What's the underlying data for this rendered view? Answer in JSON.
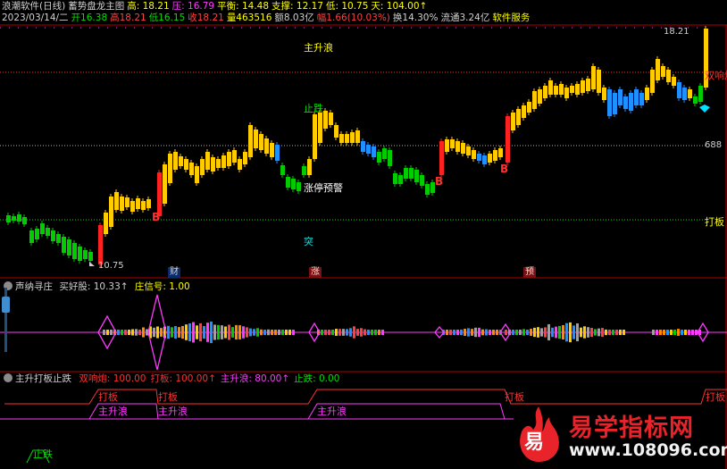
{
  "header": {
    "row1": [
      {
        "text": "浪潮软件(日线)",
        "color": "#d0d0d0"
      },
      {
        "text": "蓄势盘龙主图",
        "color": "#d0d0d0"
      },
      {
        "text": "高: 18.21",
        "color": "#ffff00"
      },
      {
        "text": "压: 16.79",
        "color": "#ff3bff"
      },
      {
        "text": "平衡: 14.48",
        "color": "#ffff00"
      },
      {
        "text": "支撑: 12.17",
        "color": "#ffff00"
      },
      {
        "text": "低: 10.75",
        "color": "#ffff00"
      },
      {
        "text": "天: 104.00↑",
        "color": "#ffff00"
      }
    ],
    "row2": [
      {
        "text": "2023/03/14/二",
        "color": "#d0d0d0"
      },
      {
        "text": "开16.38",
        "color": "#00e000"
      },
      {
        "text": "高18.21",
        "color": "#ff4040"
      },
      {
        "text": "低16.15",
        "color": "#00e000"
      },
      {
        "text": "收18.21",
        "color": "#ff4040"
      },
      {
        "text": "量463516",
        "color": "#ffff00"
      },
      {
        "text": "额8.03亿",
        "color": "#d0d0d0"
      },
      {
        "text": "幅1.66(10.03%)",
        "color": "#ff4040"
      },
      {
        "text": "换14.30%",
        "color": "#d0d0d0"
      },
      {
        "text": "流通3.24亿",
        "color": "#d0d0d0"
      },
      {
        "text": "软件服务",
        "color": "#ffff00"
      }
    ]
  },
  "main_chart": {
    "price_high_label": "18.21",
    "price_low_label": "10.75",
    "levels": [
      {
        "name": "双响炮",
        "value": "",
        "color": "#ff3030"
      },
      {
        "name": "688",
        "value": "",
        "color": "#d0d0d0"
      },
      {
        "name": "打板",
        "value": "",
        "color": "#ffff00"
      }
    ],
    "annotations": [
      "主升浪",
      "止跌",
      "涨停预警",
      "突"
    ],
    "b_signal": "B",
    "date_markers": [
      "财",
      "涨",
      "预"
    ]
  },
  "indicator1": {
    "name": "声纳寻庄",
    "value1": "买好股: 10.33↑",
    "value2": "庄信号: 1.00"
  },
  "indicator2": {
    "name": "主升打板止跌",
    "values": [
      {
        "text": "双响炮: 100.00",
        "color": "#ff3030"
      },
      {
        "text": "打板: 100.00↑",
        "color": "#ff3030"
      },
      {
        "text": "主升浪: 80.00↑",
        "color": "#ff3bff"
      },
      {
        "text": "止跌: 0.00",
        "color": "#00e000"
      }
    ],
    "labels": [
      "打板",
      "主升浪",
      "止跌"
    ]
  },
  "watermark": {
    "title": "易学指标网",
    "url": "www.108096.com",
    "glyph": "易"
  },
  "colors": {
    "up": "#ffcc00",
    "down": "#00cc00",
    "blue": "#1e90ff",
    "red": "#ff2020",
    "axis": "#b00000"
  }
}
